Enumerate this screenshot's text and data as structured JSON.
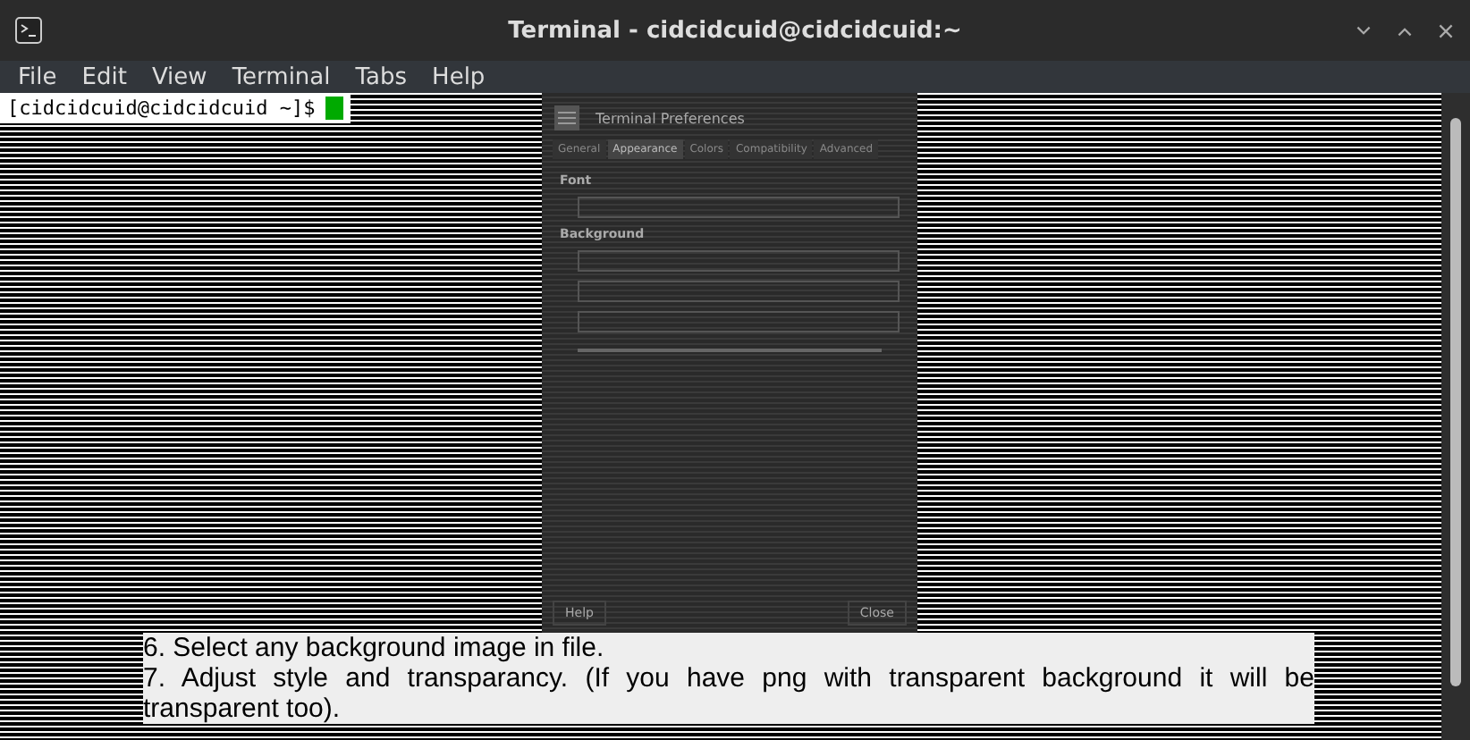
{
  "window": {
    "title": "Terminal - cidcidcuid@cidcidcuid:~"
  },
  "menu": [
    "File",
    "Edit",
    "View",
    "Terminal",
    "Tabs",
    "Help"
  ],
  "prompt": "[cidcidcuid@cidcidcuid ~]$",
  "dialog": {
    "title": "Terminal Preferences",
    "tabs": [
      {
        "label": "General",
        "selected": false
      },
      {
        "label": "Appearance",
        "selected": true
      },
      {
        "label": "Colors",
        "selected": false
      },
      {
        "label": "Compatibility",
        "selected": false
      },
      {
        "label": "Advanced",
        "selected": false
      }
    ],
    "headings": [
      "Font",
      "Background"
    ],
    "buttons": [
      "Help",
      "Close"
    ]
  },
  "page_text": [
    "6. Select any background image in file.",
    "7. Adjust style and transparancy. (If you have png with transparent background it will be transparent too)."
  ]
}
